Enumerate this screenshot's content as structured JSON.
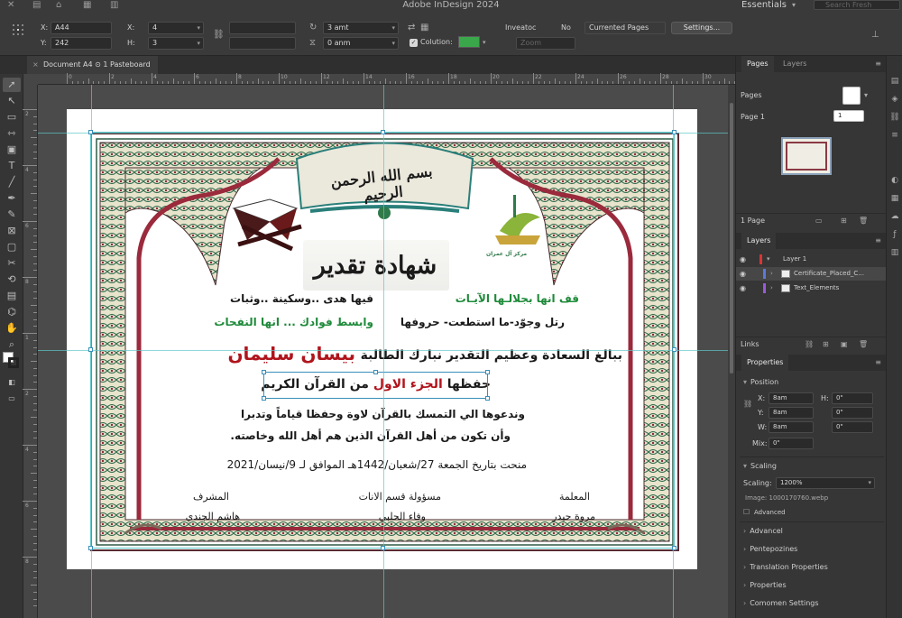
{
  "app": {
    "title": "Adobe InDesign 2024",
    "workspace": "Essentials",
    "search_placeholder": "Search Fresh"
  },
  "controlbar": {
    "x_label": "X:",
    "x_value": "A44",
    "y_label": "Y:",
    "y_value": "242",
    "x2_label": "X:",
    "x2_value": "4",
    "h_label": "H:",
    "h_value": "3",
    "amt_value": "3 amt",
    "anm_value": "0 anm",
    "column_label": "Colution:",
    "invert_label": "Inveatoc",
    "invert_value": "No",
    "pages_dropdown": "Currented Pages",
    "settings_button": "Settings...",
    "zoom_placeholder": "Zoom",
    "accent_green": "#3aa84a"
  },
  "document": {
    "tab_label": "Document A4 ⊙ 1 Pasteboard",
    "ruler_top": [
      "0",
      "2",
      "4",
      "6",
      "8",
      "10",
      "12",
      "14",
      "16",
      "18",
      "20",
      "22",
      "24",
      "26",
      "28",
      "30"
    ],
    "ruler_left": [
      "2",
      "4",
      "6",
      "8",
      "1",
      "2",
      "4",
      "6",
      "8"
    ]
  },
  "certificate": {
    "basmala": "بسم الله الرحمن الرحيم",
    "title": "شهادة تقدير",
    "line1_right": "قف انها بجلالـها الآيـات",
    "line1_left": "فيها هدى ..وسكينة ..وثبات",
    "line2_right": "رتل وجوّد-ما استطعت- حروفها",
    "line2_left": "وابسط فوادك ... انها النفحات",
    "congrats": "ببالغ السعادة وعظيم التقدير نبارك الطالبة",
    "student_name": "بيسان سليمان",
    "memorized_a": "حفظها",
    "memorized_part": "الجزء الاول",
    "memorized_b": "من القرآن الكريم",
    "prayer1": "وندعوها الي التمسك بالقرآن لاوة وحفظا قياماً وتدبرا",
    "prayer2": "وأن تكون من أهل القرآن الذين هم أهل الله وخاصته.",
    "date": "منحت بتاريخ الجمعة 27/شعبان/1442هـ الموافق لـ 9/نيسان/2021",
    "sig1_role": "المعلمة",
    "sig1_name": "مروة حيدر",
    "sig2_role": "مسؤولة قسم الانات",
    "sig2_name": "وفاء الحلبي",
    "sig3_role": "المشرف",
    "sig3_name": "هاشم الجندي",
    "logo_text": "مركز آل عمران",
    "colors": {
      "green": "#1e8a3a",
      "red": "#b0141c",
      "teal": "#2a7f7a",
      "frame": "#9a2a3c"
    }
  },
  "pages_panel": {
    "tab_pages": "Pages",
    "tab_layers": "Layers",
    "pages_label": "Pages",
    "page1_label": "Page 1",
    "page1_value": "1",
    "footer": "1 Page"
  },
  "layers_panel": {
    "title": "Layers",
    "rows": [
      "Layer 1",
      "Certificate_Placed_C...",
      "Text_Elements"
    ],
    "footer": "Links"
  },
  "properties_panel": {
    "title": "Properties",
    "position_label": "Position",
    "x_label": "X:",
    "x_value": "8am",
    "y_label": "Y:",
    "y_value": "8am",
    "w_label": "W:",
    "w_value": "8am",
    "mix_label": "Mix:",
    "mix_value": "0\"",
    "h_label": "H:",
    "h_value": "0\"",
    "r_value": "0\"",
    "h2_value": "0\"",
    "scaling_label": "Scaling",
    "scaling_field_label": "Scaling:",
    "scaling_value": "1200%",
    "image_label": "Image: 1000170760.webp",
    "advanced_check": "Advanced",
    "sections": [
      "Advancel",
      "Pentepozines",
      "Translation Properties",
      "Properties",
      "Comomen Settings"
    ]
  }
}
